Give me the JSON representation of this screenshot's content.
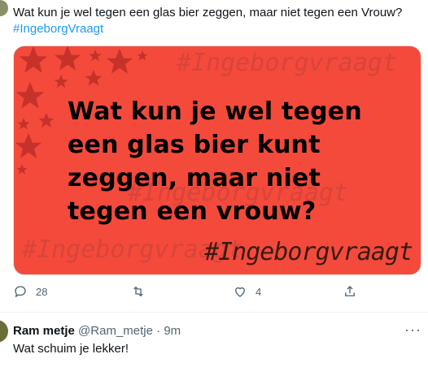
{
  "tweet": {
    "text": "Wat kun je wel tegen een glas bier zeggen, maar niet tegen een Vrouw?",
    "hashtag": "#IngeborgVraagt"
  },
  "media": {
    "background": "#f44a3b",
    "headline": "Wat kun je wel tegen\neen glas bier kunt\nzeggen, maar niet\ntegen een vrouw?",
    "tag": "#Ingeborgvraagt"
  },
  "actions": {
    "reply_count": "28",
    "retweet_count": "",
    "like_count": "4",
    "icons": [
      "reply-icon",
      "retweet-icon",
      "like-icon",
      "share-icon"
    ]
  },
  "reply": {
    "name": "Ram metje",
    "handle": "@Ram_metje",
    "separator": "·",
    "time": "9m",
    "text": "Wat schuim je lekker!",
    "more": "···"
  }
}
